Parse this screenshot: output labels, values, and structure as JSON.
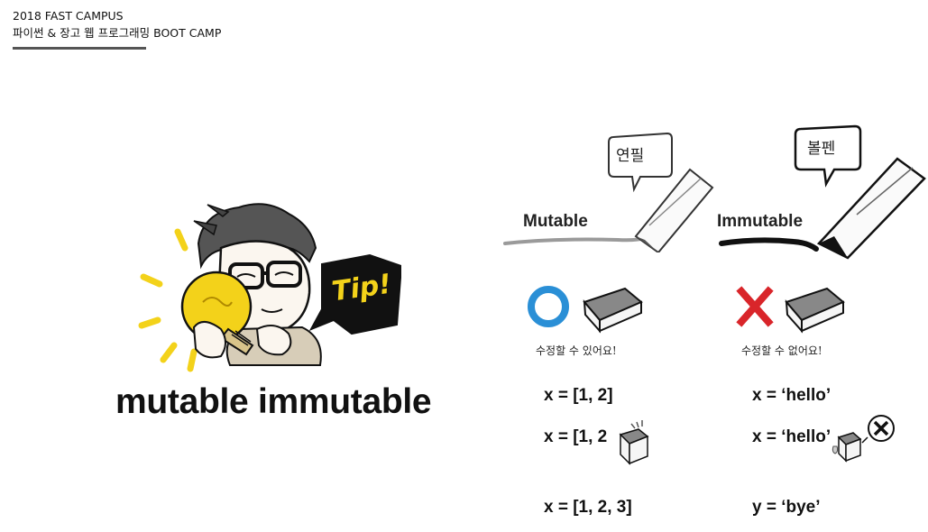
{
  "header": {
    "line1": "2018 FAST CAMPUS",
    "line2": "파이썬 & 장고 웹 프로그래밍 BOOT CAMP"
  },
  "title": "mutable immutable",
  "tip_label": "Tip!",
  "mutable": {
    "label": "Mutable",
    "bubble": "연필",
    "caption": "수정할 수 있어요!",
    "code": [
      "x = [1, 2]",
      "x = [1, 2",
      "x = [1, 2, 3]"
    ]
  },
  "immutable": {
    "label": "Immutable",
    "bubble": "볼펜",
    "caption": "수정할 수 없어요!",
    "code": [
      "x = ‘hello’",
      "x = ‘hello’",
      "y = ‘bye’"
    ]
  },
  "colors": {
    "circle_blue": "#2a8fd6",
    "cross_red": "#d9252a",
    "bulb_yellow": "#f3d21a",
    "tip_black": "#111111"
  },
  "icons": [
    "lightbulb-icon",
    "eraser-icon",
    "pencil-icon",
    "pen-icon",
    "circle-o-icon",
    "cross-x-icon"
  ]
}
